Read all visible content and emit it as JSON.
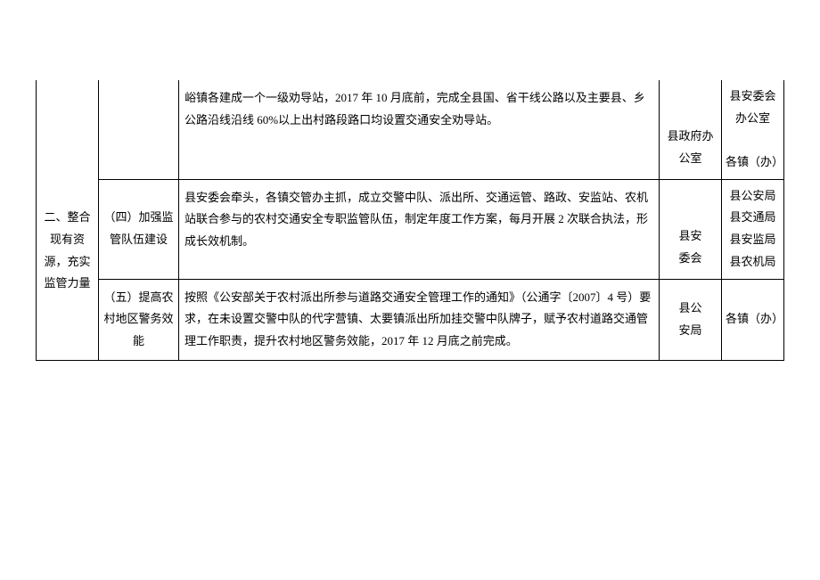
{
  "rows": [
    {
      "category": "",
      "sub": "",
      "desc": "峪镇各建成一个一级劝导站，2017 年 10 月底前，完成全县国、省干线公路以及主要县、乡公路沿线沿线 60%以上出村路段路口均设置交通安全劝导站。",
      "resp": "县政府办公室",
      "coop": "县安委会办公室\n\n各镇（办）"
    },
    {
      "category": "二、整合现有资源，充实监管力量",
      "sub": "（四）加强监管队伍建设",
      "desc": "县安委会牵头，各镇交管办主抓，成立交警中队、派出所、交通运管、路政、安监站、农机站联合参与的农村交通安全专职监管队伍，制定年度工作方案，每月开展 2 次联合执法，形成长效机制。",
      "resp": "县安\n委会",
      "coop": "县公安局县交通局县安监局县农机局"
    },
    {
      "category": "",
      "sub": "（五）提高农村地区警务效能",
      "desc": "按照《公安部关于农村派出所参与道路交通安全管理工作的通知》（公通字〔2007〕4 号）要求，在未设置交警中队的代字营镇、太要镇派出所加挂交警中队牌子，赋予农村道路交通管理工作职责，提升农村地区警务效能，2017 年 12 月底之前完成。",
      "resp": "县公\n安局",
      "coop": "各镇（办）"
    }
  ]
}
